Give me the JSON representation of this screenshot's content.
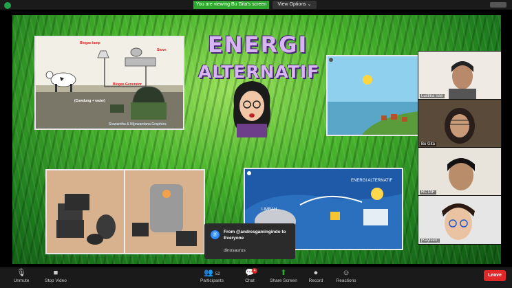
{
  "topbar": {
    "viewing_text": "You are viewing Bu Gita's screen",
    "view_options": "View Options ⌄"
  },
  "slide": {
    "title_line1": "ENERGI",
    "title_line2": "ALTERNATIF",
    "biogas": {
      "lamp": "Biogas lamp",
      "stove": "Stove",
      "generator": "Biogas Generator",
      "input": "(Cowdung + water)",
      "credit": "Siswantha & Nijowardana Graphics"
    },
    "diagram": {
      "title": "ENERGI ALTERNATIF",
      "waste": "LIMBAH"
    }
  },
  "participants": [
    {
      "name": "Lustina Sari"
    },
    {
      "name": "Bu Gita"
    },
    {
      "name": "RCTAF"
    },
    {
      "name": "[Kayleen]"
    }
  ],
  "chat_popup": {
    "avatar": "@",
    "from": "From @andresgamingindo to Everyone",
    "message": "dinosaurus"
  },
  "toolbar": {
    "unmute": "Unmute",
    "stop_video": "Stop Video",
    "participants": "Participants",
    "participants_count": "52",
    "chat": "Chat",
    "chat_badge": "4",
    "share_screen": "Share Screen",
    "record": "Record",
    "reactions": "Reactions",
    "leave": "Leave"
  },
  "colors": {
    "share_green": "#2ea82e",
    "leave_red": "#e02828",
    "title_purple": "#d7b6f2"
  }
}
